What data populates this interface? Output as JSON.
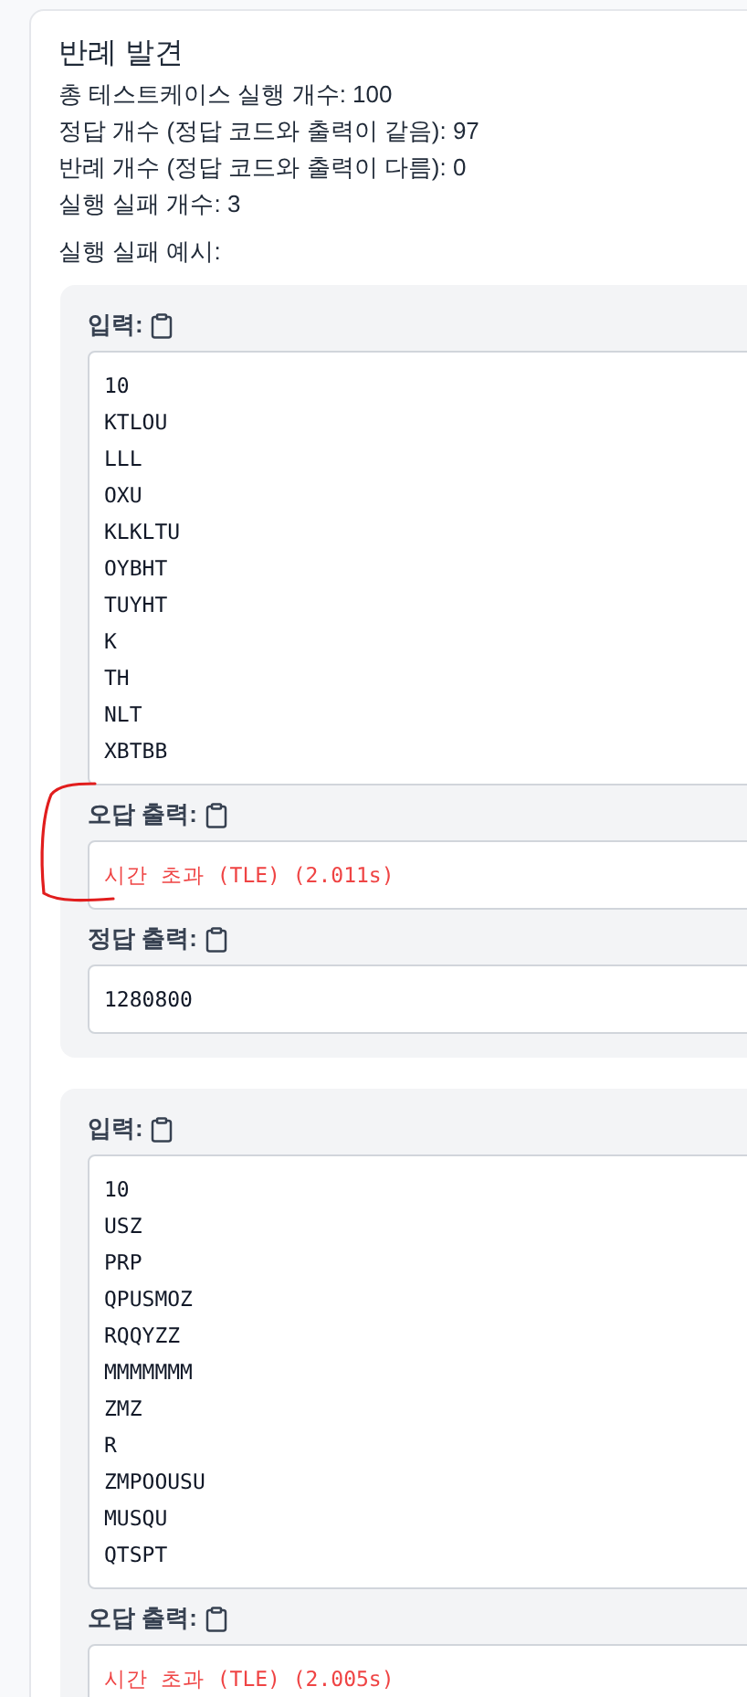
{
  "title": "반례 발견",
  "stats": [
    "총 테스트케이스 실행 개수: 100",
    "정답 개수 (정답 코드와 출력이 같음): 97",
    "반례 개수 (정답 코드와 출력이 다름): 0",
    "실행 실패 개수: 3"
  ],
  "examples_heading": "실행 실패 예시:",
  "examples": [
    {
      "sections": [
        {
          "kind": "input",
          "label": "입력:",
          "lines": [
            "10",
            "KTLOU",
            "LLL",
            "OXU",
            "KLKLTU",
            "OYBHT",
            "TUYHT",
            "K",
            "TH",
            "NLT",
            "XBTBB"
          ]
        },
        {
          "kind": "error",
          "label": "오답 출력:",
          "lines": [
            "시간 초과 (TLE) (2.011s)"
          ],
          "annotated": true
        },
        {
          "kind": "output",
          "label": "정답 출력:",
          "lines": [
            "1280800"
          ]
        }
      ]
    },
    {
      "sections": [
        {
          "kind": "input",
          "label": "입력:",
          "lines": [
            "10",
            "USZ",
            "PRP",
            "QPUSMOZ",
            "RQQYZZ",
            "MMMMMMM",
            "ZMZ",
            "R",
            "ZMPOOUSU",
            "MUSQU",
            "QTSPT"
          ]
        },
        {
          "kind": "error",
          "label": "오답 출력:",
          "lines": [
            "시간 초과 (TLE) (2.005s)"
          ],
          "annotated": false
        }
      ]
    }
  ]
}
